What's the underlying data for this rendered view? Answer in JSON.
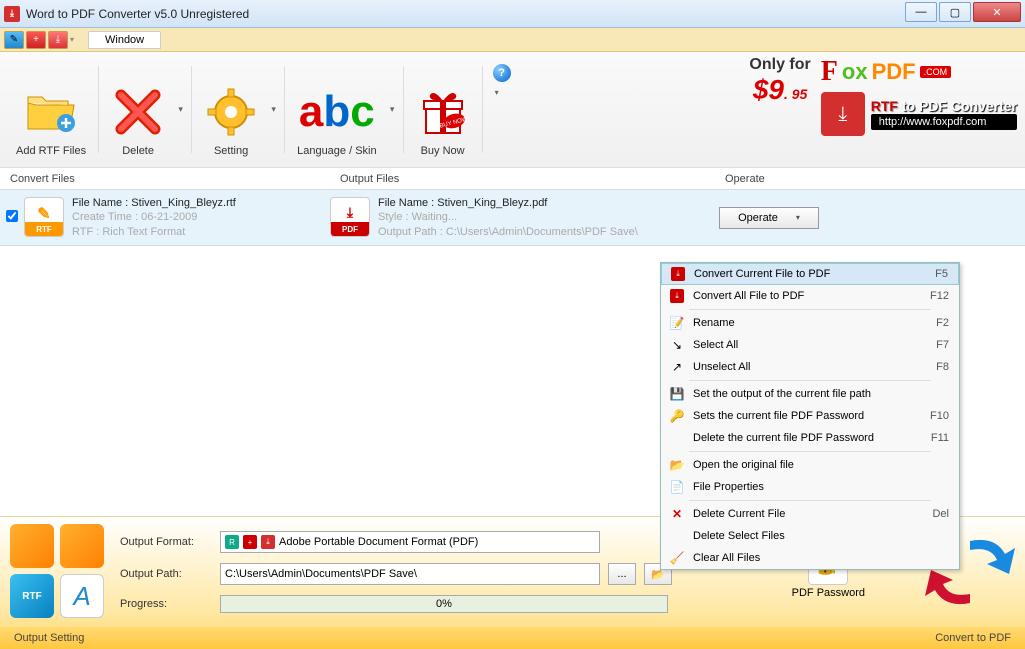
{
  "title": "Word to PDF Converter v5.0 Unregistered",
  "tabs": {
    "window": "Window"
  },
  "toolbar": {
    "add": "Add RTF Files",
    "delete": "Delete",
    "setting": "Setting",
    "language": "Language / Skin",
    "buynow": "Buy Now"
  },
  "promo": {
    "only": "Only for",
    "price": "$9",
    "cents": ". 95",
    "fox_ox": "ox",
    "fox_pdf": "PDF",
    "com": ".COM",
    "banner_rtf": "RTF",
    "banner_rest": " to PDF Converter",
    "url": "http://www.foxpdf.com"
  },
  "columns": {
    "convert": "Convert Files",
    "output": "Output Files",
    "operate": "Operate"
  },
  "row": {
    "in_name_label": "File Name : ",
    "in_name": "Stiven_King_Bleyz.rtf",
    "in_time": "Create Time : 06-21-2009",
    "in_type": "RTF : Rich Text Format",
    "out_name_label": "File Name : ",
    "out_name": "Stiven_King_Bleyz.pdf",
    "out_style": "Style : Waiting...",
    "out_path": "Output Path : C:\\Users\\Admin\\Documents\\PDF Save\\",
    "operate_btn": "Operate"
  },
  "menu": {
    "items": [
      {
        "label": "Convert Current File to PDF",
        "shortcut": "F5",
        "icon": "pdf-red",
        "hl": true
      },
      {
        "label": "Convert All File to PDF",
        "shortcut": "F12",
        "icon": "pdf-red"
      },
      {
        "sep": true
      },
      {
        "label": "Rename",
        "shortcut": "F2",
        "icon": "rename"
      },
      {
        "label": "Select All",
        "shortcut": "F7",
        "icon": "select"
      },
      {
        "label": "Unselect All",
        "shortcut": "F8",
        "icon": "unselect"
      },
      {
        "sep": true
      },
      {
        "label": "Set the output of the current file path",
        "icon": "disk"
      },
      {
        "label": "Sets the current file PDF Password",
        "shortcut": "F10",
        "icon": "key"
      },
      {
        "label": "Delete the current file PDF Password",
        "shortcut": "F11",
        "icon": ""
      },
      {
        "sep": true
      },
      {
        "label": "Open the original file",
        "icon": "folder"
      },
      {
        "label": "File Properties",
        "icon": "props"
      },
      {
        "sep": true
      },
      {
        "label": "Delete Current File",
        "shortcut": "Del",
        "icon": "x"
      },
      {
        "label": "Delete Select Files",
        "icon": ""
      },
      {
        "label": "Clear All Files",
        "icon": "broom"
      }
    ]
  },
  "bottom": {
    "format_label": "Output Format:",
    "format_value": "Adobe Portable Document Format (PDF)",
    "path_label": "Output Path:",
    "path_value": "C:\\Users\\Admin\\Documents\\PDF Save\\",
    "progress_label": "Progress:",
    "progress_value": "0%",
    "browse": "...",
    "pdf_password": "PDF Password",
    "output_setting": "Output Setting",
    "convert": "Convert to PDF"
  }
}
